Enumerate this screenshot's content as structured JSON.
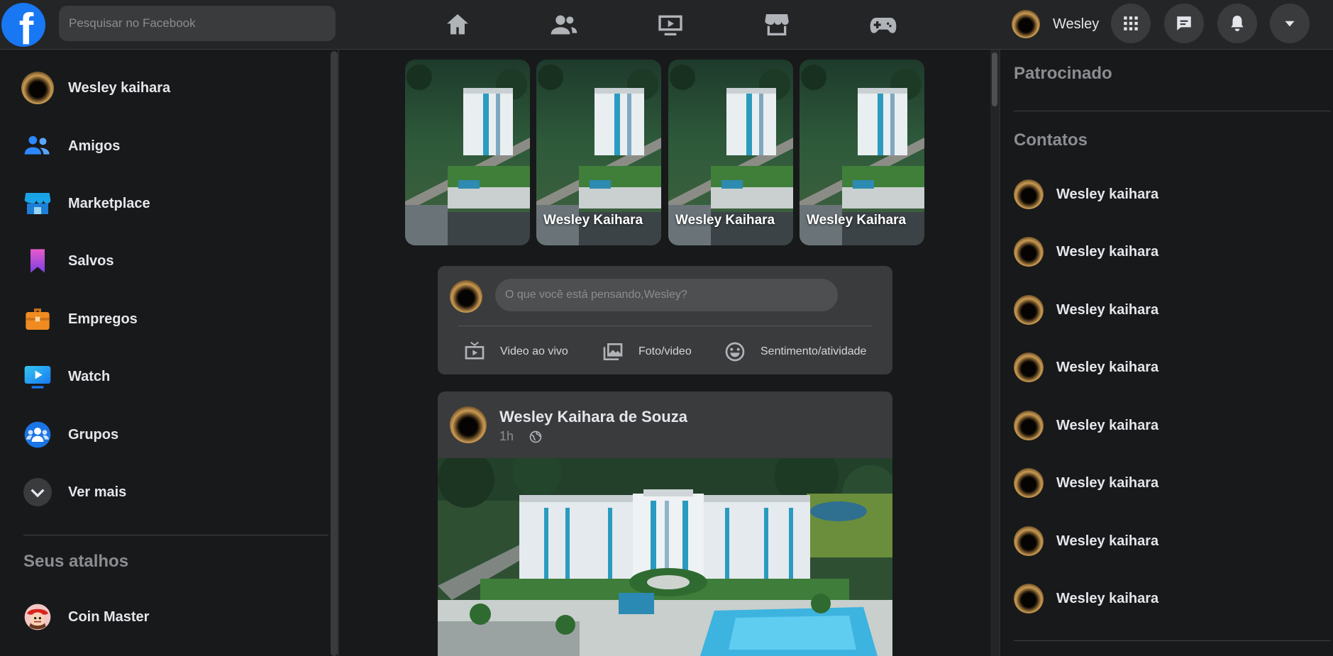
{
  "header": {
    "logo_text": "f",
    "search_placeholder": "Pesquisar no Facebook",
    "nav": [
      "home-icon",
      "friends-icon",
      "watch-icon",
      "marketplace-icon",
      "gaming-icon"
    ],
    "profile_name": "Wesley",
    "buttons": [
      "menu-grid-icon",
      "messenger-icon",
      "notifications-icon",
      "account-dropdown-icon"
    ]
  },
  "sidebar": {
    "items": [
      {
        "label": "Wesley kaihara",
        "icon": "avatar"
      },
      {
        "label": "Amigos",
        "icon": "friends-icon"
      },
      {
        "label": "Marketplace",
        "icon": "marketplace-icon"
      },
      {
        "label": "Salvos",
        "icon": "bookmark-icon"
      },
      {
        "label": "Empregos",
        "icon": "briefcase-icon"
      },
      {
        "label": "Watch",
        "icon": "watch-icon"
      },
      {
        "label": "Grupos",
        "icon": "groups-icon"
      },
      {
        "label": "Ver mais",
        "icon": "chevron-down-icon"
      }
    ],
    "shortcuts_title": "Seus atalhos",
    "shortcuts": [
      {
        "label": "Coin Master",
        "icon": "coin-master-icon"
      }
    ]
  },
  "stories": [
    {
      "name": ""
    },
    {
      "name": "Wesley Kaihara"
    },
    {
      "name": "Wesley Kaihara"
    },
    {
      "name": "Wesley Kaihara"
    }
  ],
  "composer": {
    "placeholder": "O que você está pensando,Wesley?",
    "actions": [
      "Video ao vivo",
      "Foto/video",
      "Sentimento/atividade"
    ]
  },
  "post": {
    "author": "Wesley Kaihara de Souza",
    "time": "1h",
    "privacy_icon": "globe-icon"
  },
  "right": {
    "sponsored_title": "Patrocinado",
    "contacts_title": "Contatos",
    "contacts": [
      "Wesley kaihara",
      "Wesley kaihara",
      "Wesley kaihara",
      "Wesley kaihara",
      "Wesley kaihara",
      "Wesley kaihara",
      "Wesley kaihara",
      "Wesley kaihara"
    ]
  },
  "colors": {
    "background": "#18191a",
    "surface": "#242526",
    "card": "#3a3b3c",
    "accent": "#1877f2",
    "text": "#e4e6eb",
    "muted": "#8a8d91"
  }
}
